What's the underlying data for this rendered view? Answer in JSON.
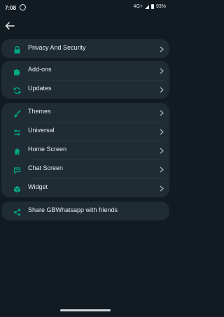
{
  "status": {
    "time": "7:08",
    "network": "4G+",
    "battery": "93%"
  },
  "groups": [
    {
      "items": [
        {
          "id": "privacy",
          "label": "Privacy And Security",
          "icon": "lock-icon"
        }
      ]
    },
    {
      "items": [
        {
          "id": "addons",
          "label": "Add-ons",
          "icon": "puzzle-icon"
        },
        {
          "id": "updates",
          "label": "Updates",
          "icon": "refresh-icon"
        }
      ]
    },
    {
      "items": [
        {
          "id": "themes",
          "label": "Themes",
          "icon": "paintbrush-icon"
        },
        {
          "id": "universal",
          "label": "Universal",
          "icon": "sliders-icon"
        },
        {
          "id": "home-screen",
          "label": "Home Screen",
          "icon": "home-icon"
        },
        {
          "id": "chat-screen",
          "label": "Chat Screen",
          "icon": "chat-icon"
        },
        {
          "id": "widget",
          "label": "Widget",
          "icon": "cube-icon"
        }
      ]
    },
    {
      "items": [
        {
          "id": "share",
          "label": "Share GBWhatsapp with friends",
          "icon": "share-icon"
        }
      ]
    }
  ],
  "colors": {
    "accent": "#00a884",
    "card": "#1f2c34",
    "background": "#121b22"
  }
}
